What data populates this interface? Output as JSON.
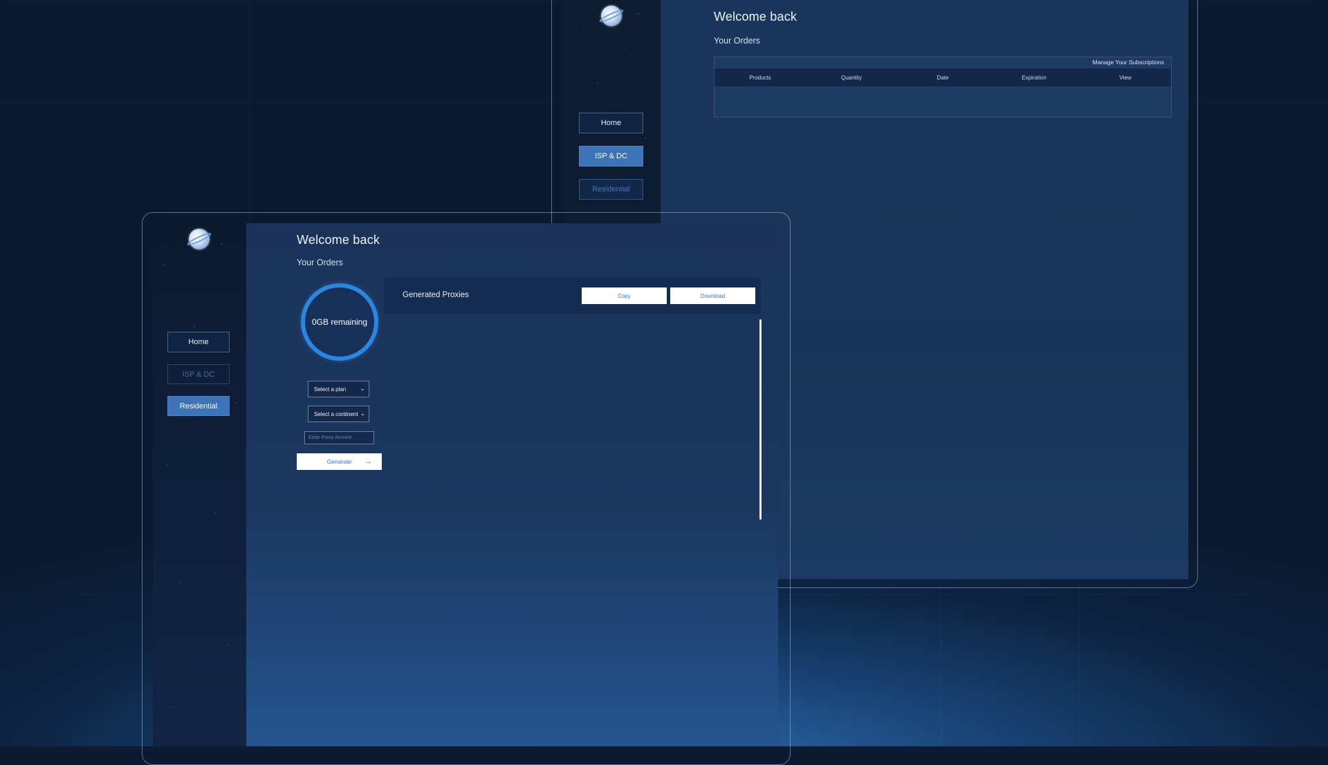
{
  "back_window": {
    "nav": {
      "home": "Home",
      "isp_dc": "ISP & DC",
      "residential": "Residential"
    },
    "welcome": "Welcome back",
    "subtitle": "Your Orders",
    "manage_link": "Manage Your Subscriptions",
    "table_headers": [
      "Products",
      "Quantity",
      "Date",
      "Expiration",
      "View"
    ]
  },
  "front_window": {
    "nav": {
      "home": "Home",
      "isp_dc": "ISP & DC",
      "residential": "Residential"
    },
    "welcome": "Welcome back",
    "subtitle": "Your Orders",
    "ring_label": "0GB remaining",
    "plan_select": "Select a plan",
    "continent_select": "Select a continent",
    "proxy_placeholder": "Enter Proxy Amount",
    "generate_label": "Generate",
    "proxies_title": "Generated Proxies",
    "copy_label": "Copy",
    "download_label": "Download"
  },
  "colors": {
    "accent": "#2b86e0",
    "active_nav": "#3d73b8",
    "background": "#0a1a30"
  },
  "icons": {
    "logo": "globe-logo-icon",
    "chevron": "chevron-down-icon",
    "arrow": "arrow-right-icon"
  }
}
